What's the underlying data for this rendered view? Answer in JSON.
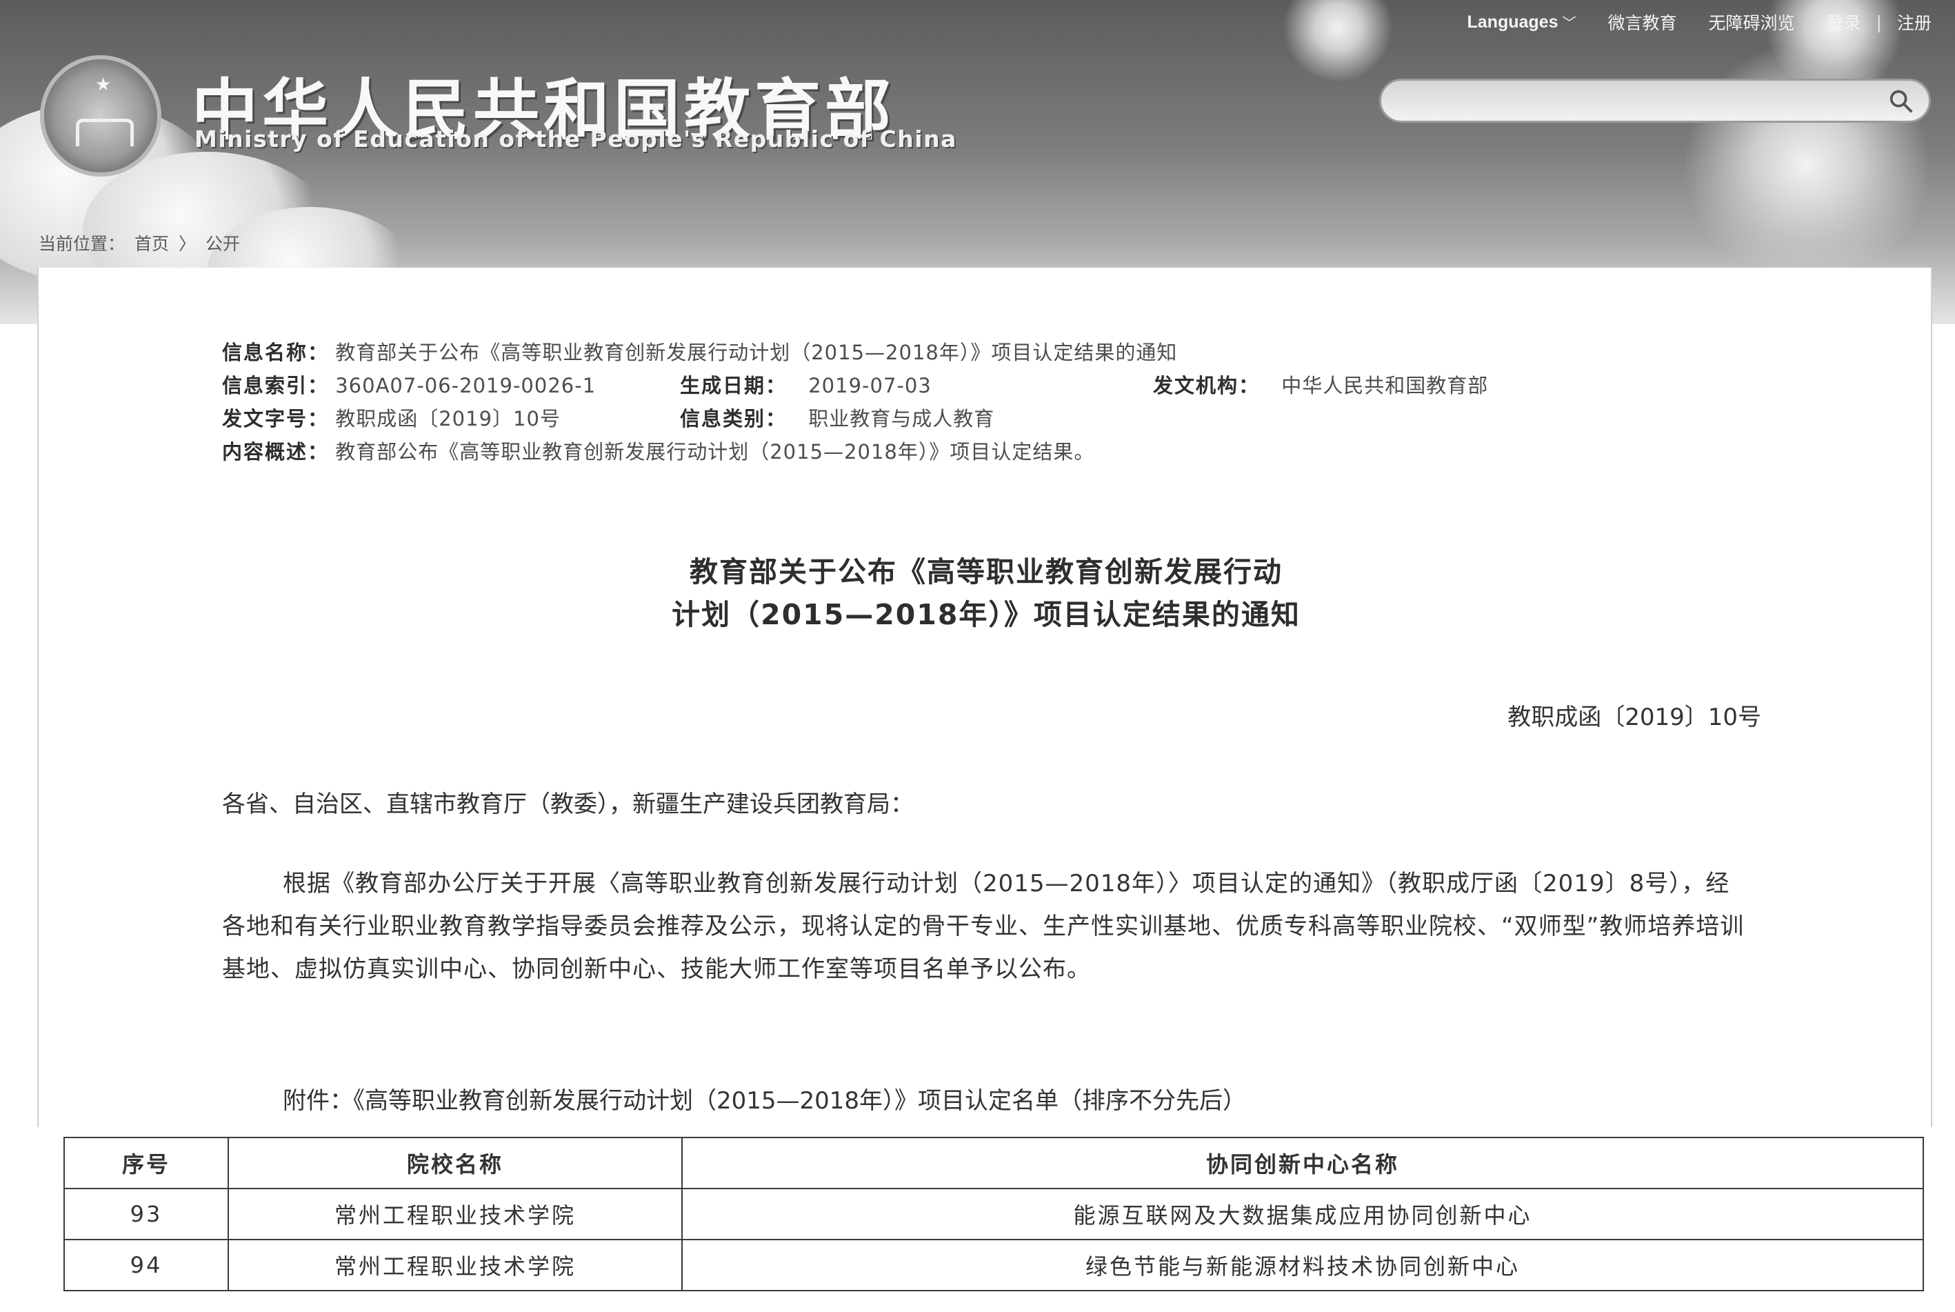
{
  "header": {
    "site_title": "中华人民共和国教育部",
    "site_subtitle": "Ministry of Education of the People's Republic of China",
    "topnav": {
      "languages": "Languages",
      "weiyan": "微言教育",
      "accessible": "无障碍浏览",
      "login": "登录",
      "divider": "|",
      "register": "注册"
    },
    "search_placeholder": ""
  },
  "breadcrumb": {
    "label": "当前位置：",
    "home": "首页",
    "separator": "〉",
    "current": "公开"
  },
  "meta": {
    "name_label": "信息名称：",
    "name_value": "教育部关于公布《高等职业教育创新发展行动计划（2015—2018年）》项目认定结果的通知",
    "index_label": "信息索引：",
    "index_value": "360A07-06-2019-0026-1",
    "date_label": "生成日期：",
    "date_value": "2019-07-03",
    "issuer_label": "发文机构：",
    "issuer_value": "中华人民共和国教育部",
    "docno_label": "发文字号：",
    "docno_value": "教职成函〔2019〕10号",
    "category_label": "信息类别：",
    "category_value": "职业教育与成人教育",
    "summary_label": "内容概述：",
    "summary_value": "教育部公布《高等职业教育创新发展行动计划（2015—2018年）》项目认定结果。"
  },
  "document": {
    "title_line1": "教育部关于公布《高等职业教育创新发展行动",
    "title_line2": "计划（2015—2018年）》项目认定结果的通知",
    "doc_number": "教职成函〔2019〕10号",
    "addressee": "各省、自治区、直辖市教育厅（教委），新疆生产建设兵团教育局：",
    "body": "根据《教育部办公厅关于开展〈高等职业教育创新发展行动计划（2015—2018年）〉项目认定的通知》（教职成厅函〔2019〕8号），经各地和有关行业职业教育教学指导委员会推荐及公示，现将认定的骨干专业、生产性实训基地、优质专科高等职业院校、“双师型”教师培养培训基地、虚拟仿真实训中心、协同创新中心、技能大师工作室等项目名单予以公布。",
    "attachment": "附件：《高等职业教育创新发展行动计划（2015—2018年）》项目认定名单（排序不分先后）"
  },
  "table": {
    "headers": [
      "序号",
      "院校名称",
      "协同创新中心名称"
    ],
    "rows": [
      [
        "93",
        "常州工程职业技术学院",
        "能源互联网及大数据集成应用协同创新中心"
      ],
      [
        "94",
        "常州工程职业技术学院",
        "绿色节能与新能源材料技术协同创新中心"
      ]
    ]
  }
}
